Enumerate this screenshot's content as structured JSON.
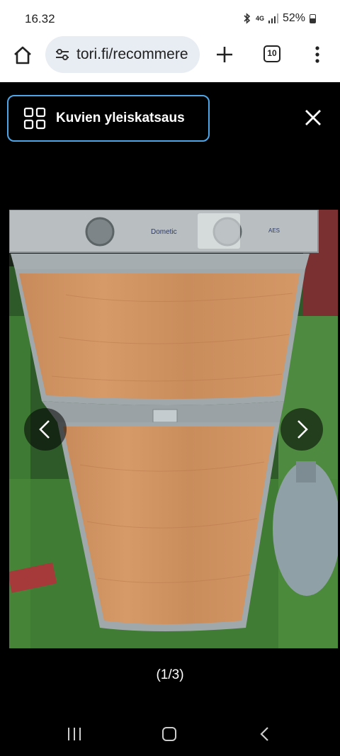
{
  "status": {
    "time": "16.32",
    "network": "4G",
    "battery": "52%"
  },
  "browser": {
    "url": "tori.fi/recommere",
    "tab_count": "10"
  },
  "gallery": {
    "overview_label": "Kuvien yleiskatsaus",
    "counter": "(1/3)",
    "photo_brand": "Dometic",
    "photo_badge": "AES"
  },
  "colors": {
    "accent": "#4da6e8",
    "pill_bg": "#e8edf3",
    "overlay": "#000000"
  }
}
